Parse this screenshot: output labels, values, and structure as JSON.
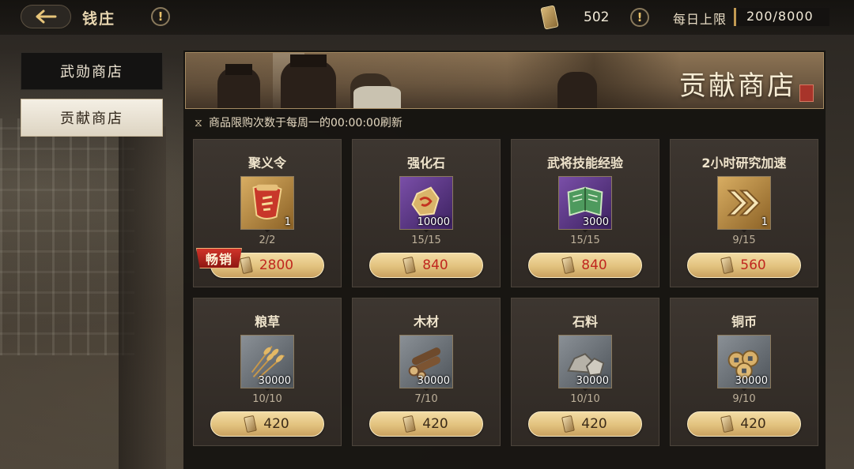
{
  "header": {
    "title": "钱庄",
    "currency_value": "502",
    "daily_limit_label": "每日上限",
    "daily_limit_value": "200/8000"
  },
  "sidebar": {
    "items": [
      {
        "label": "武勋商店",
        "active": false
      },
      {
        "label": "贡献商店",
        "active": true
      }
    ]
  },
  "shop": {
    "banner_title": "贡献商店",
    "notice": "商品限购次数于每周一的00:00:00刷新",
    "hot_badge": "畅销",
    "items": [
      {
        "name": "聚义令",
        "quantity": "1",
        "limit": "2/2",
        "price": "2800",
        "price_color": "red",
        "icon": "recruit-token-icon"
      },
      {
        "name": "强化石",
        "quantity": "10000",
        "limit": "15/15",
        "price": "840",
        "price_color": "red",
        "icon": "enhance-stone-icon"
      },
      {
        "name": "武将技能经验",
        "quantity": "3000",
        "limit": "15/15",
        "price": "840",
        "price_color": "red",
        "icon": "skill-book-icon"
      },
      {
        "name": "2小时研究加速",
        "quantity": "1",
        "limit": "9/15",
        "price": "560",
        "price_color": "red",
        "icon": "research-speedup-icon"
      },
      {
        "name": "粮草",
        "quantity": "30000",
        "limit": "10/10",
        "price": "420",
        "price_color": "dark",
        "icon": "grain-icon"
      },
      {
        "name": "木材",
        "quantity": "30000",
        "limit": "7/10",
        "price": "420",
        "price_color": "dark",
        "icon": "wood-icon"
      },
      {
        "name": "石料",
        "quantity": "30000",
        "limit": "10/10",
        "price": "420",
        "price_color": "dark",
        "icon": "stone-icon"
      },
      {
        "name": "铜币",
        "quantity": "30000",
        "limit": "9/10",
        "price": "420",
        "price_color": "dark",
        "icon": "copper-coin-icon"
      }
    ]
  },
  "colors": {
    "accent_gold": "#e2c27e",
    "price_red": "#c0271f",
    "hot_badge_red": "#c02a22"
  }
}
